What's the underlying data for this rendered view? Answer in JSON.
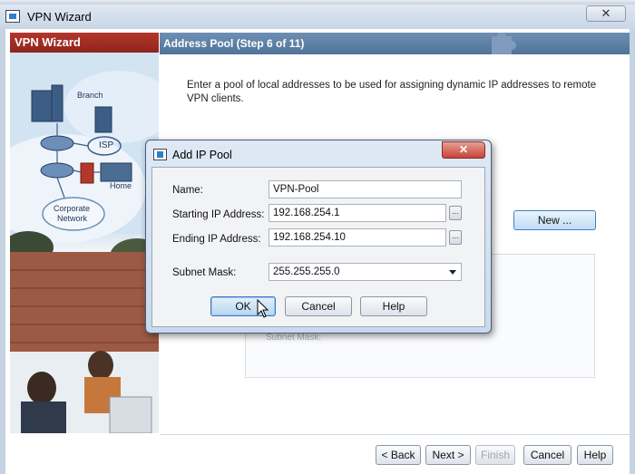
{
  "wizard": {
    "title": "VPN Wizard",
    "close_label": "✕",
    "side_title": "VPN Wizard",
    "step_title": "Address Pool  (Step 6 of 11)",
    "intro": "Enter a pool of local addresses to be used for assigning dynamic IP addresses to remote VPN clients.",
    "new_button": "New ...",
    "ghost_text": "Subnet Mask:",
    "art_labels": {
      "branch": "Branch",
      "isp": "ISP",
      "home": "Home",
      "corporate_1": "Corporate",
      "corporate_2": "Network"
    },
    "footer": {
      "back": "< Back",
      "next": "Next >",
      "finish": "Finish",
      "cancel": "Cancel",
      "help": "Help"
    }
  },
  "dialog": {
    "title": "Add IP Pool",
    "close_label": "✕",
    "fields": {
      "name_label": "Name:",
      "name_value": "VPN-Pool",
      "start_label": "Starting IP Address:",
      "start_value": "192.168.254.1",
      "end_label": "Ending IP Address:",
      "end_value": "192.168.254.10",
      "mask_label": "Subnet Mask:",
      "mask_value": "255.255.255.0"
    },
    "browse_label": "...",
    "buttons": {
      "ok": "OK",
      "cancel": "Cancel",
      "help": "Help"
    }
  },
  "colors": {
    "side_header": "#a22e24",
    "step_header": "#5b7ea4",
    "dialog_close": "#c7443a",
    "primary_button": "#3b78c2"
  }
}
